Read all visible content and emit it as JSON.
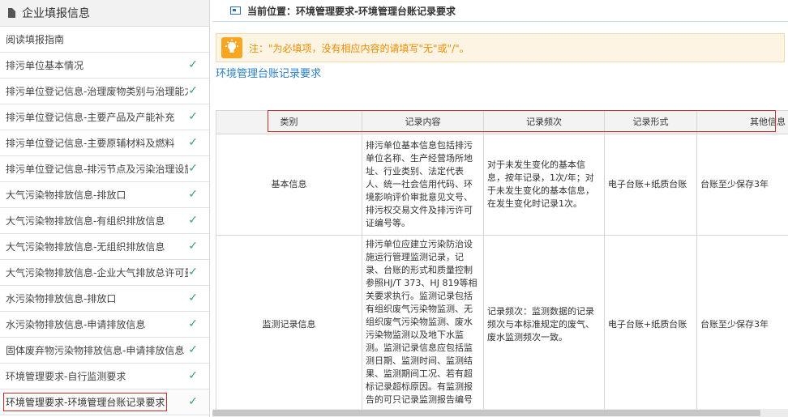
{
  "sidebar": {
    "title": "企业填报信息",
    "items": [
      {
        "label": "阅读填报指南",
        "checked": false
      },
      {
        "label": "排污单位基本情况",
        "checked": true
      },
      {
        "label": "排污单位登记信息-治理废物类别与治理能力",
        "checked": true
      },
      {
        "label": "排污单位登记信息-主要产品及产能补充",
        "checked": true
      },
      {
        "label": "排污单位登记信息-主要原辅材料及燃料",
        "checked": true
      },
      {
        "label": "排污单位登记信息-排污节点及污染治理设施",
        "checked": true
      },
      {
        "label": "大气污染物排放信息-排放口",
        "checked": true
      },
      {
        "label": "大气污染物排放信息-有组织排放信息",
        "checked": true
      },
      {
        "label": "大气污染物排放信息-无组织排放信息",
        "checked": true
      },
      {
        "label": "大气污染物排放信息-企业大气排放总许可量",
        "checked": true
      },
      {
        "label": "水污染物排放信息-排放口",
        "checked": true
      },
      {
        "label": "水污染物排放信息-申请排放信息",
        "checked": true
      },
      {
        "label": "固体废弃物污染物排放信息-申请排放信息",
        "checked": true
      },
      {
        "label": "环境管理要求-自行监测要求",
        "checked": true
      },
      {
        "label": "环境管理要求-环境管理台账记录要求",
        "checked": true,
        "active": true
      }
    ],
    "check_glyph": "✓"
  },
  "breadcrumb": "当前位置：环境管理要求-环境管理台账记录要求",
  "notice": "注：\"为必填项，没有相应内容的请填写\"无\"或\"/\"。",
  "section_title": "环境管理台账记录要求",
  "table": {
    "headers": [
      "类别",
      "记录内容",
      "记录频次",
      "记录形式",
      "其他信息"
    ],
    "rows": [
      {
        "category": "基本信息",
        "content": "排污单位基本信息包括排污单位名称、生产经营场所地址、行业类别、法定代表人、统一社会信用代码、环境影响评价审批意见文号、排污权交易文件及排污许可证编号等。",
        "frequency": "对于未发生变化的基本信息，按年记录，1次/年；对于未发生变化的基本信息，在发生变化时记录1次。",
        "form": "电子台账+纸质台账",
        "other": "台账至少保存3年"
      },
      {
        "category": "监测记录信息",
        "content": "排污单位应建立污染防治设施运行管理监测记录，记录、台账的形式和质量控制参照HJ/T 373、HJ 819等相关要求执行。监测记录包括有组织废气污染物监测、无组织废气污染物监测、废水污染物监测以及地下水监测。监测记录信息应包括监测日期、监测时间、监测结果、监测期间工况、若有超标记录超标原因。有监测报告的可只记录监测报告编号",
        "frequency": "记录频次：监测数据的记录频次与本标准规定的废气、废水监测频次一致。",
        "form": "电子台账+纸质台账",
        "other": "台账至少保存3年"
      }
    ]
  },
  "colors": {
    "accent": "#2c7fc9",
    "check": "#3da35a",
    "highlight": "#cc2b2b",
    "notice_text": "#f08c00"
  }
}
